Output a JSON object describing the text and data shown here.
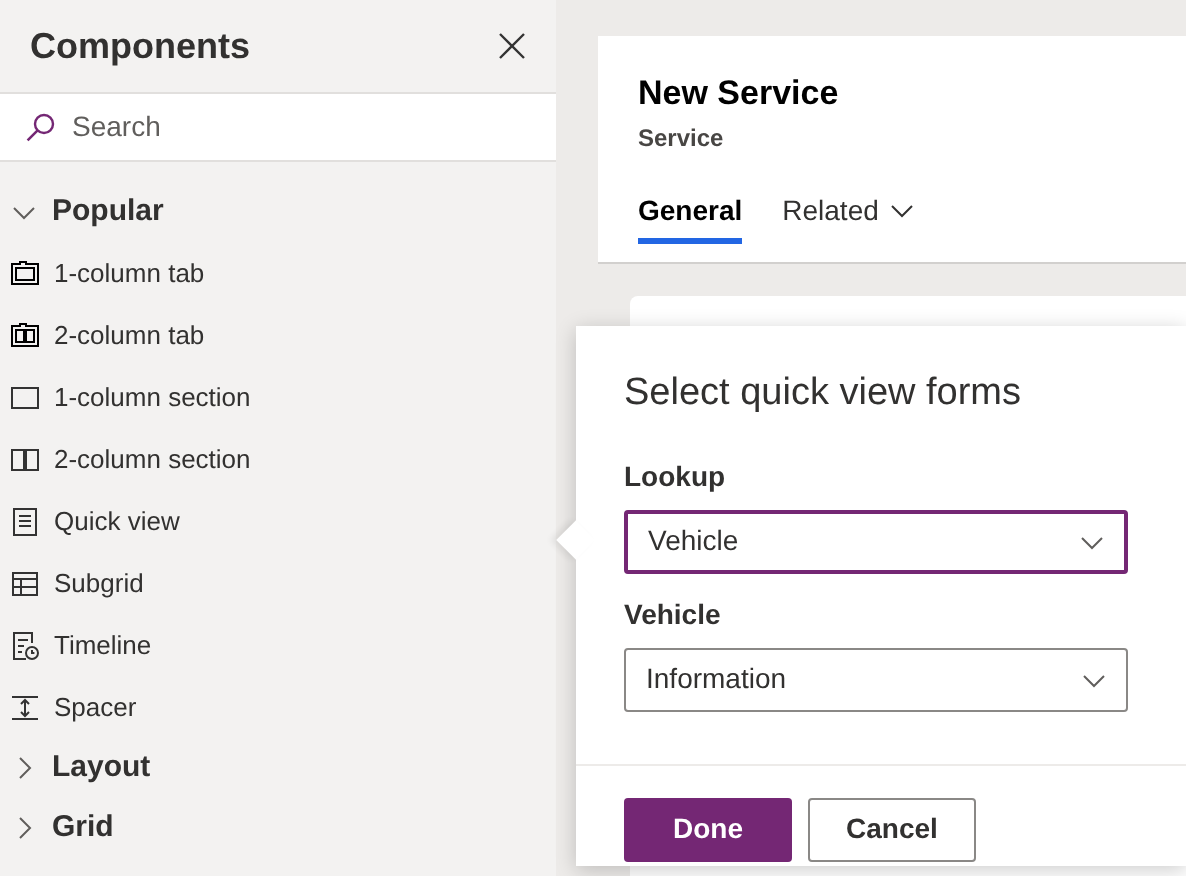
{
  "panel": {
    "title": "Components",
    "search": {
      "placeholder": "Search"
    },
    "sections": [
      {
        "label": "Popular",
        "expanded": true,
        "items": [
          {
            "label": "1-column tab"
          },
          {
            "label": "2-column tab"
          },
          {
            "label": "1-column section"
          },
          {
            "label": "2-column section"
          },
          {
            "label": "Quick view"
          },
          {
            "label": "Subgrid"
          },
          {
            "label": "Timeline"
          },
          {
            "label": "Spacer"
          }
        ]
      },
      {
        "label": "Layout",
        "expanded": false
      },
      {
        "label": "Grid",
        "expanded": false
      }
    ]
  },
  "form": {
    "title": "New Service",
    "subtitle": "Service",
    "tabs": [
      {
        "label": "General",
        "selected": true,
        "dropdown": false
      },
      {
        "label": "Related",
        "selected": false,
        "dropdown": true
      }
    ]
  },
  "dialog": {
    "title": "Select quick view forms",
    "fields": [
      {
        "label": "Lookup",
        "value": "Vehicle",
        "focused": true
      },
      {
        "label": "Vehicle",
        "value": "Information",
        "focused": false
      }
    ],
    "buttons": [
      {
        "label": "Done",
        "primary": true
      },
      {
        "label": "Cancel",
        "primary": false
      }
    ]
  }
}
